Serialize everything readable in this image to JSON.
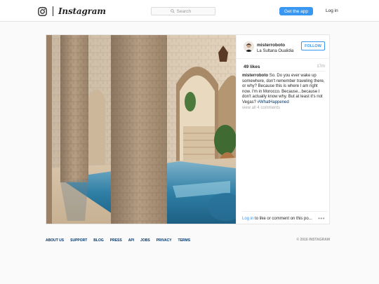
{
  "header": {
    "wordmark": "Instagram",
    "search_placeholder": "Search",
    "get_app_label": "Get the app",
    "login_label": "Log in"
  },
  "post": {
    "username": "misterroboto",
    "location": "La Sultana Oualidia",
    "follow_label": "FOLLOW",
    "likes": "49 likes",
    "time": "17m",
    "caption_text": "So. Do you ever wake up somewhere, don't remember traveling there, or why? Because this is where I am right now. I'm in Morocco. Because...because I don't actually know why. But at least it's not Vegas?",
    "hashtag": "#WhatHappened",
    "view_all": "view all 4 comments",
    "login_link": "Log in",
    "login_rest": " to like or comment on this po...",
    "more": "•••"
  },
  "footer": {
    "links": [
      "About us",
      "Support",
      "Blog",
      "Press",
      "API",
      "Jobs",
      "Privacy",
      "Terms"
    ],
    "copyright": "© 2016 Instagram"
  },
  "colors": {
    "accent": "#3897f0",
    "link_dark": "#003569",
    "muted": "#a5a7aa"
  }
}
